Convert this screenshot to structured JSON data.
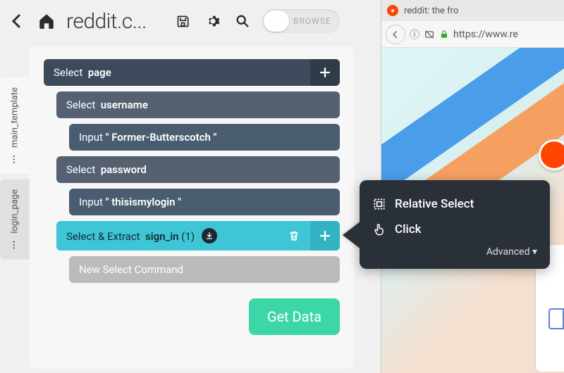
{
  "header": {
    "title": "reddit.c...",
    "toggle_label": "BROWSE"
  },
  "tabs": [
    {
      "id": "main_template",
      "label": "main_template",
      "active": true
    },
    {
      "id": "login_page",
      "label": "login_page",
      "active": false
    }
  ],
  "commands": {
    "select_page": {
      "verb": "Select",
      "target": "page"
    },
    "select_username": {
      "verb": "Select",
      "target": "username"
    },
    "input_username": {
      "verb": "Input",
      "value": "\" Former-Butterscotch \""
    },
    "select_password": {
      "verb": "Select",
      "target": "password"
    },
    "input_password": {
      "verb": "Input",
      "value": "\" thisismylogin \""
    },
    "extract_signin": {
      "verb": "Select & Extract",
      "target": "sign_in",
      "count": "(1)"
    },
    "new_cmd": "New Select Command"
  },
  "get_data_label": "Get Data",
  "popup": {
    "relative_select": "Relative Select",
    "click": "Click",
    "advanced": "Advanced"
  },
  "browser": {
    "tab_title": "reddit: the fro",
    "url": "https://www.re"
  }
}
